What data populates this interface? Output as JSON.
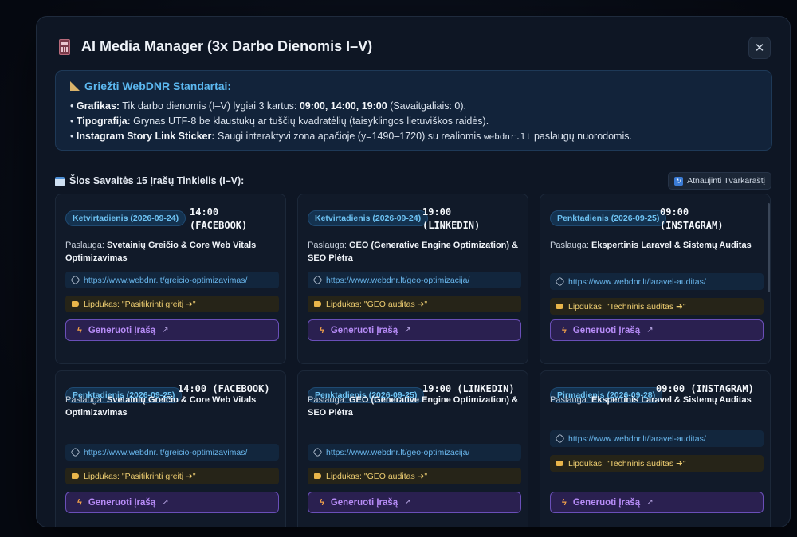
{
  "modal": {
    "title": "AI Media Manager (3x Darbo Dienomis I–V)",
    "close_label": "✕"
  },
  "standards": {
    "title": "Griežti WebDNR Standartai:",
    "lines": [
      {
        "label": "Grafikas:",
        "text1": " Tik darbo dienomis (I–V) lygiai 3 kartus: ",
        "bold": "09:00, 14:00, 19:00",
        "text2": " (Savaitgaliais: 0)."
      },
      {
        "label": "Tipografija:",
        "text1": " Grynas UTF-8 be klaustukų ar tuščių kvadratėlių (taisyklingos lietuviškos raidės).",
        "bold": "",
        "text2": ""
      },
      {
        "label": "Instagram Story Link Sticker:",
        "text1": " Saugi interaktyvi zona apačioje (y=1490–1720) su realiomis ",
        "mono": "webdnr.lt",
        "text2": " paslaugų nuorodomis."
      }
    ]
  },
  "grid": {
    "title": "Šios Savaitės 15 Įrašų Tinklelis (I–V):",
    "refresh_label": "Atnaujinti Tvarkaraštį"
  },
  "cards": [
    {
      "day": "Ketvirtadienis (2026-09-24)",
      "time": "14:00\n(FACEBOOK)",
      "service_prefix": "Paslauga: ",
      "service": "Svetainių Greičio & Core Web Vitals Optimizavimas",
      "url": "https://www.webdnr.lt/greicio-optimizavimas/",
      "sticker": "Lipdukas: \"Pasitikrinti greitį ➜\"",
      "button": "Generuoti Įrašą"
    },
    {
      "day": "Ketvirtadienis (2026-09-24)",
      "time": "19:00\n(LINKEDIN)",
      "service_prefix": "Paslauga: ",
      "service": "GEO (Generative Engine Optimization) & SEO Plėtra",
      "url": "https://www.webdnr.lt/geo-optimizacija/",
      "sticker": "Lipdukas: \"GEO auditas ➜\"",
      "button": "Generuoti Įrašą"
    },
    {
      "day": "Penktadienis (2026-09-25)",
      "time": "09:00\n(INSTAGRAM)",
      "service_prefix": "Paslauga: ",
      "service": "Ekspertinis Laravel & Sistemų Auditas",
      "url": "https://www.webdnr.lt/laravel-auditas/",
      "sticker": "Lipdukas: \"Techninis auditas ➜\"",
      "button": "Generuoti Įrašą"
    },
    {
      "day": "Penktadienis (2026-09-25)",
      "time": "14:00 (FACEBOOK)",
      "service_prefix": "Paslauga: ",
      "service": "Svetainių Greičio & Core Web Vitals Optimizavimas",
      "url": "https://www.webdnr.lt/greicio-optimizavimas/",
      "sticker": "Lipdukas: \"Pasitikrinti greitį ➜\"",
      "button": "Generuoti Įrašą"
    },
    {
      "day": "Penktadienis (2026-09-25)",
      "time": "19:00 (LINKEDIN)",
      "service_prefix": "Paslauga: ",
      "service": "GEO (Generative Engine Optimization) & SEO Plėtra",
      "url": "https://www.webdnr.lt/geo-optimizacija/",
      "sticker": "Lipdukas: \"GEO auditas ➜\"",
      "button": "Generuoti Įrašą"
    },
    {
      "day": "Pirmadienis (2026-09-28)",
      "time": "09:00 (INSTAGRAM)",
      "service_prefix": "Paslauga: ",
      "service": "Ekspertinis Laravel & Sistemų Auditas",
      "url": "https://www.webdnr.lt/laravel-auditas/",
      "sticker": "Lipdukas: \"Techninis auditas ➜\"",
      "button": "Generuoti Įrašą"
    }
  ],
  "icons": {
    "title": "calculator-icon",
    "standards": "triangle-ruler-icon",
    "grid": "calendar-icon",
    "refresh": "refresh-icon",
    "link": "link-icon",
    "sticker": "label-tag-icon",
    "button": "lightning-bolt-icon"
  },
  "colors": {
    "accent_blue": "#5cb8f0",
    "button_purple": "#b78cf7",
    "sticker_yellow": "#f0cf72"
  }
}
